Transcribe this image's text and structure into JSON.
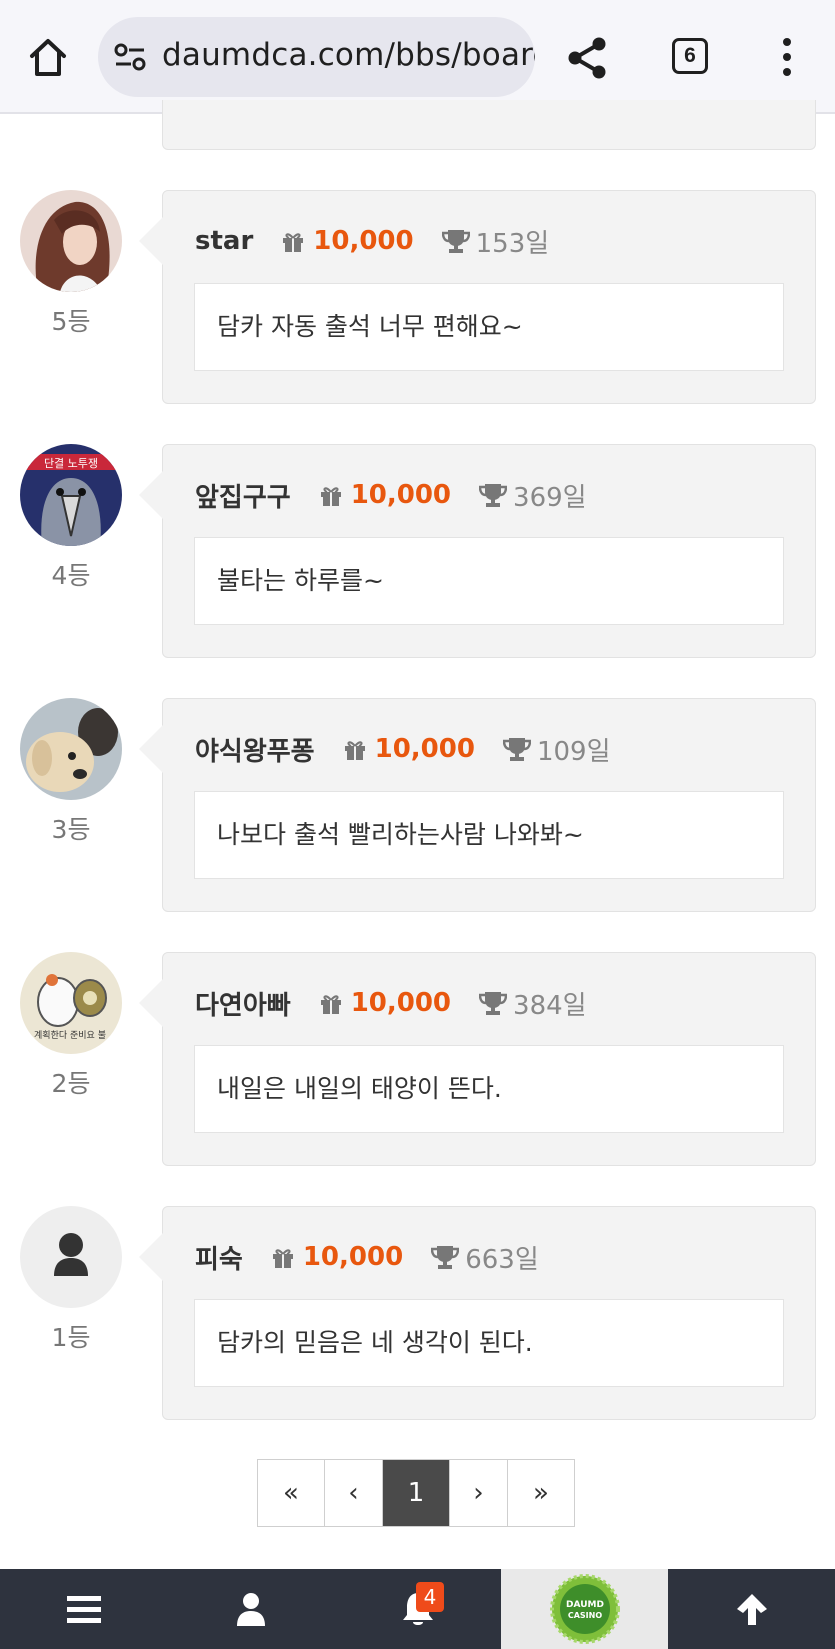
{
  "browser": {
    "url": "daumdca.com/bbs/board",
    "tab_count": "6"
  },
  "entries": [
    {
      "name": "star",
      "points": "10,000",
      "days": "153일",
      "comment": "담카 자동 출석 너무 편해요~",
      "rank": "5등",
      "avatar": "photo-woman"
    },
    {
      "name": "앞집구구",
      "points": "10,000",
      "days": "369일",
      "comment": "불타는 하루를~",
      "rank": "4등",
      "avatar": "cartoon-bird"
    },
    {
      "name": "야식왕푸퐁",
      "points": "10,000",
      "days": "109일",
      "comment": "나보다 출석 빨리하는사람 나와봐~",
      "rank": "3등",
      "avatar": "photo-dog"
    },
    {
      "name": "다연아빠",
      "points": "10,000",
      "days": "384일",
      "comment": "내일은 내일의 태양이 뜬다.",
      "rank": "2등",
      "avatar": "cartoon-hamster"
    },
    {
      "name": "피숙",
      "points": "10,000",
      "days": "663일",
      "comment": "담카의 믿음은 네 생각이 된다.",
      "rank": "1등",
      "avatar": "default-user"
    }
  ],
  "pagination": {
    "first": "«",
    "prev": "‹",
    "current": "1",
    "next": "›",
    "last": "»"
  },
  "bottom_nav": {
    "notification_count": "4",
    "logo_text_top": "DAUMD",
    "logo_text_bottom": "CASINO"
  },
  "colors": {
    "points": "#e8570e",
    "nav_bg": "#2e333e",
    "badge": "#ef4b1a"
  }
}
